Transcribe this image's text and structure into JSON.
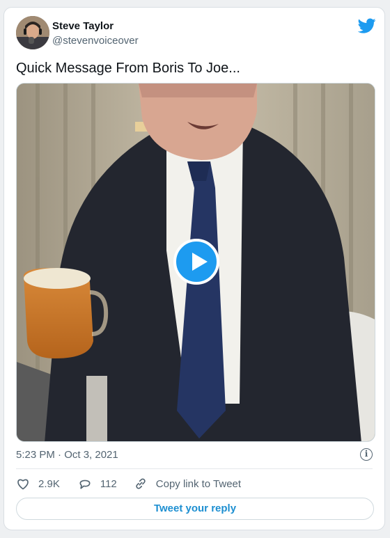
{
  "author": {
    "name": "Steve Taylor",
    "handle": "@stevenvoiceover"
  },
  "tweet": {
    "text": "Quick Message From Boris To Joe...",
    "timestamp": "5:23 PM · Oct 3, 2021"
  },
  "media": {
    "type": "video",
    "play_icon": "play-icon"
  },
  "actions": {
    "likes": "2.9K",
    "replies": "112",
    "copy_link": "Copy link to Tweet"
  },
  "reply_button": "Tweet your reply",
  "colors": {
    "accent": "#1d9bf0",
    "reply_text": "#1d8fd1",
    "muted": "#536471"
  }
}
